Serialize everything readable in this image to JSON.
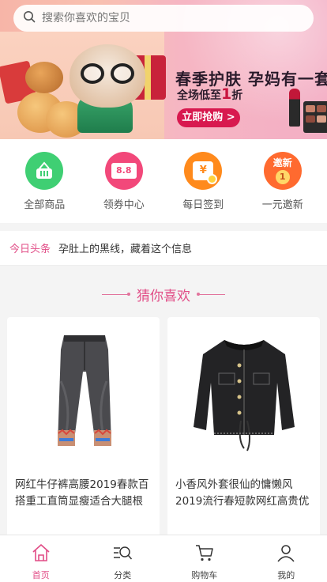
{
  "search": {
    "placeholder": "搜索你喜欢的宝贝",
    "icon": "search-icon"
  },
  "banner": {
    "title": "春季护肤 孕妈有一套",
    "subtitle_prefix": "全场低至",
    "subtitle_number": "1",
    "subtitle_suffix": "折",
    "button_label": "立即抢购 >"
  },
  "quick_nav": [
    {
      "label": "全部商品",
      "icon": "basket-icon",
      "color": "#3fcf73"
    },
    {
      "label": "领券中心",
      "icon": "coupon-icon",
      "color": "#f2487a",
      "badge": "8.8"
    },
    {
      "label": "每日签到",
      "icon": "calendar-checkin-icon",
      "color": "#ff8a1c",
      "badge": "¥"
    },
    {
      "label": "一元邀新",
      "icon": "invite-icon",
      "color": "#ff6a2f",
      "badge": "邀新",
      "coin": "1"
    }
  ],
  "headline": {
    "tag": "今日头条",
    "text": "孕肚上的黑线，藏着这个信息"
  },
  "section": {
    "title": "猜你喜欢"
  },
  "products": [
    {
      "title": "网红牛仔裤高腰2019春款百搭重工直筒显瘦适合大腿根",
      "image": "jeans-image"
    },
    {
      "title": "小香风外套很仙的慵懒风2019流行春短款网红高贵优",
      "image": "black-jacket-image"
    }
  ],
  "tabbar": [
    {
      "label": "首页",
      "icon": "home-icon",
      "active": true
    },
    {
      "label": "分类",
      "icon": "category-search-icon",
      "active": false
    },
    {
      "label": "购物车",
      "icon": "cart-icon",
      "active": false
    },
    {
      "label": "我的",
      "icon": "user-icon",
      "active": false
    }
  ],
  "colors": {
    "accent": "#e14c86",
    "banner_button": "#d8194f"
  }
}
